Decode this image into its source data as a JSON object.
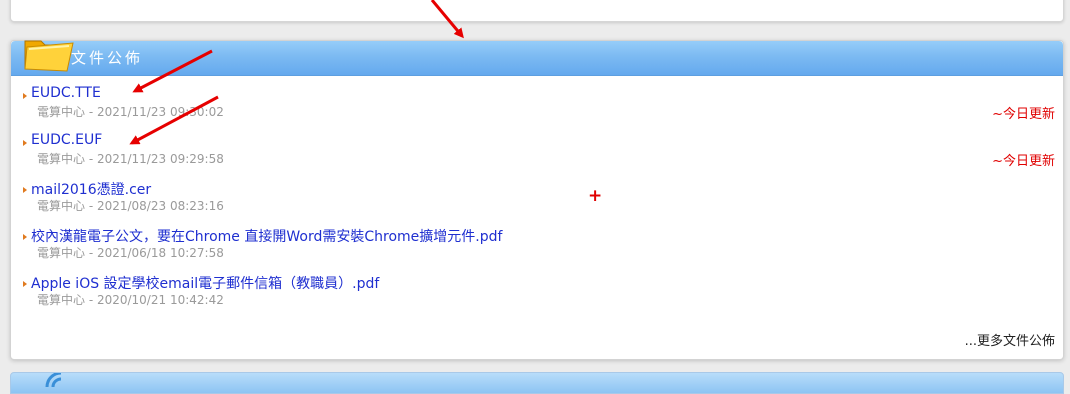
{
  "panel": {
    "title": "文件公佈",
    "items": [
      {
        "title": "EUDC.TTE",
        "meta": "電算中心 - 2021/11/23 09:30:02",
        "badge": "~今日更新"
      },
      {
        "title": "EUDC.EUF",
        "meta": "電算中心 - 2021/11/23 09:29:58",
        "badge": "~今日更新"
      },
      {
        "title": "mail2016憑證.cer",
        "meta": "電算中心 - 2021/08/23 08:23:16",
        "badge": ""
      },
      {
        "title": "校內漢龍電子公文，要在Chrome 直接開Word需安裝Chrome擴增元件.pdf",
        "meta": "電算中心 - 2021/06/18 10:27:58",
        "badge": ""
      },
      {
        "title": "Apple iOS 設定學校email電子郵件信箱（教職員）.pdf",
        "meta": "電算中心 - 2020/10/21 10:42:42",
        "badge": ""
      }
    ],
    "more_label": "...更多文件公佈"
  },
  "annotations": {
    "plus_mark": "+",
    "arrow_color": "#e60000"
  },
  "colors": {
    "header_blue": "#7cbaf2",
    "link_blue": "#1f2fd0",
    "badge_red": "#e00000",
    "meta_gray": "#9a9a9a",
    "bullet_orange": "#e07a1f"
  },
  "icons": {
    "header": "folder-icon",
    "bullet": "triangle-bullet-icon",
    "bottom": "rss-icon"
  }
}
